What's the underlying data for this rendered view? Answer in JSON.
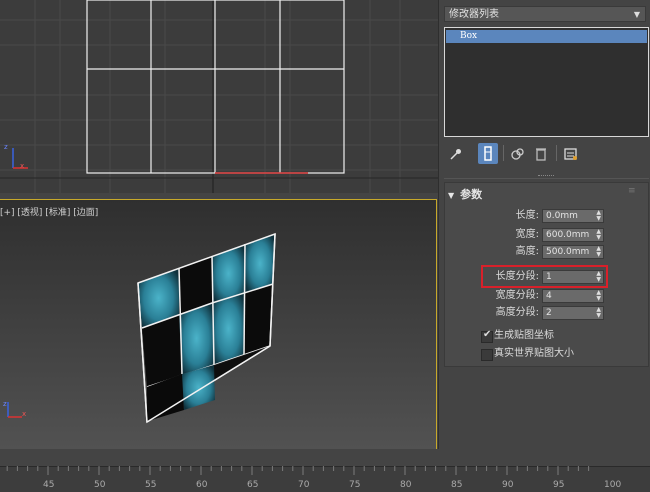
{
  "top_viewport": {
    "axis_x": "x",
    "axis_y": "z"
  },
  "persp_viewport": {
    "label": "[+] [透视] [标准] [边面]",
    "axis_x": "x",
    "axis_y": "z"
  },
  "modifier_panel": {
    "modifier_list_label": "修改器列表",
    "stack_items": [
      "Box"
    ]
  },
  "params": {
    "title": "参数",
    "length_label": "长度:",
    "length_value": "0.0mm",
    "width_label": "宽度:",
    "width_value": "600.0mm",
    "height_label": "高度:",
    "height_value": "500.0mm",
    "length_segs_label": "长度分段:",
    "length_segs_value": "1",
    "width_segs_label": "宽度分段:",
    "width_segs_value": "4",
    "height_segs_label": "高度分段:",
    "height_segs_value": "2",
    "gen_mapping_label": "生成贴图坐标",
    "gen_mapping_checked": true,
    "real_world_label": "真实世界贴图大小",
    "real_world_checked": false
  },
  "timeline": {
    "ticks": [
      "45",
      "50",
      "55",
      "60",
      "65",
      "70",
      "75",
      "80",
      "85",
      "90",
      "95",
      "100"
    ]
  },
  "colors": {
    "active_viewport_border": "#c7a92a",
    "stack_highlight": "#5b86bd",
    "callout": "#d9202a",
    "material": "#2f8fa6"
  }
}
